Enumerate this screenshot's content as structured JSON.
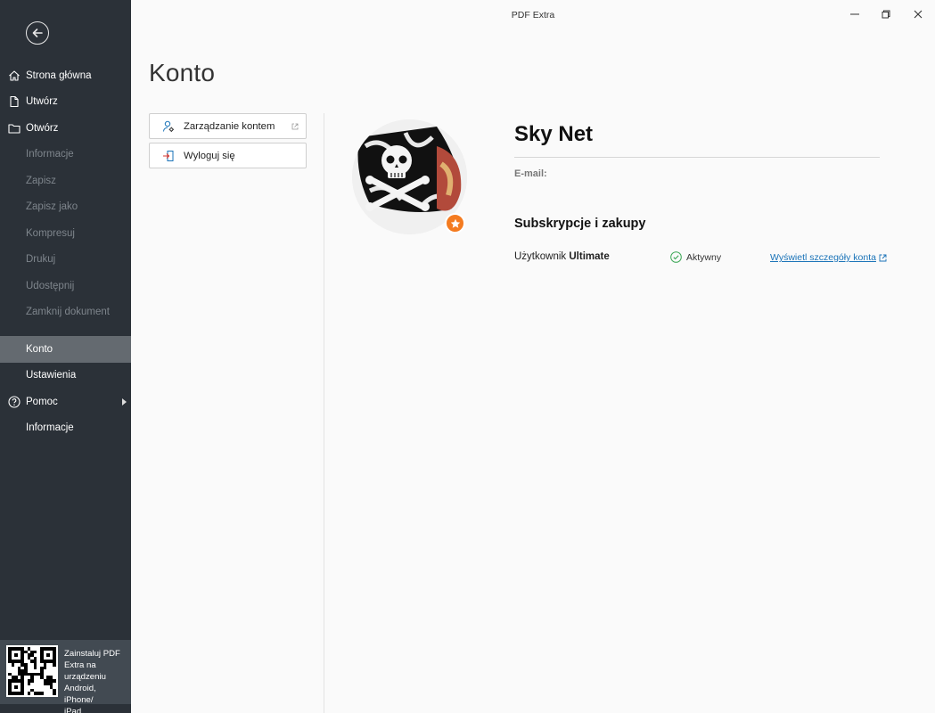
{
  "window": {
    "title": "PDF Extra"
  },
  "sidebar": {
    "items": [
      {
        "label": "Strona główna",
        "icon": "home-icon"
      },
      {
        "label": "Utwórz",
        "icon": "file-icon"
      },
      {
        "label": "Otwórz",
        "icon": "folder-icon"
      },
      {
        "label": "Informacje"
      },
      {
        "label": "Zapisz"
      },
      {
        "label": "Zapisz jako"
      },
      {
        "label": "Kompresuj"
      },
      {
        "label": "Drukuj"
      },
      {
        "label": "Udostępnij"
      },
      {
        "label": "Zamknij dokument"
      }
    ],
    "bottom_items": [
      {
        "label": "Konto",
        "active": true
      },
      {
        "label": "Ustawienia"
      },
      {
        "label": "Pomoc",
        "icon": "help-icon"
      },
      {
        "label": "Informacje"
      }
    ],
    "promo": {
      "lines": [
        "Zainstaluj PDF",
        "Extra na",
        "urządzeniu",
        "Android, iPhone/",
        "iPad."
      ]
    }
  },
  "page": {
    "title": "Konto"
  },
  "actions": {
    "manage_account": "Zarządzanie kontem",
    "logout": "Wyloguj się"
  },
  "account": {
    "name": "Sky Net",
    "email_label": "E-mail:",
    "subscriptions_title": "Subskrypcje i zakupy",
    "user_type_prefix": "Użytkownik",
    "user_type": "Ultimate",
    "status": "Aktywny",
    "details_link": "Wyświetl szczegóły konta"
  },
  "colors": {
    "sidebar_bg": "#2b3138",
    "sidebar_active": "#646a70",
    "badge": "#f47b20",
    "link": "#1a73b8",
    "status_ok": "#3aa655"
  }
}
